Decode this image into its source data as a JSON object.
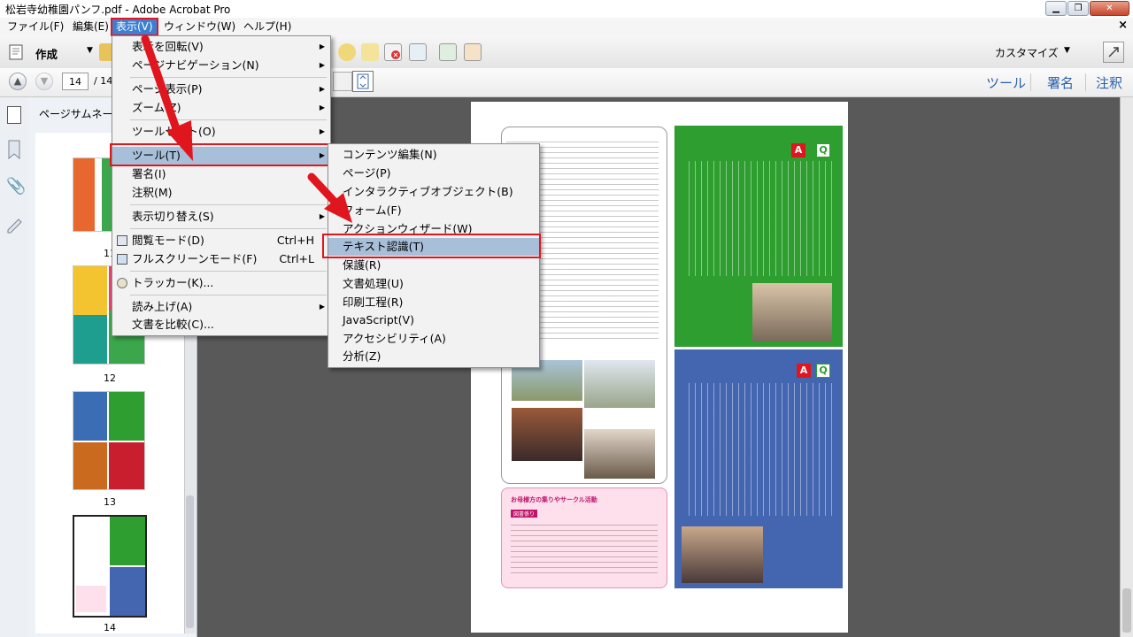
{
  "window": {
    "title": "松岩寺幼稚園パンフ.pdf - Adobe Acrobat Pro"
  },
  "menubar": [
    {
      "label": "ファイル(F)"
    },
    {
      "label": "編集(E)"
    },
    {
      "label": "表示(V)"
    },
    {
      "label": "ウィンドウ(W)"
    },
    {
      "label": "ヘルプ(H)"
    }
  ],
  "toolbar": {
    "create_label": "作成",
    "customize_label": "カスタマイズ"
  },
  "nav": {
    "page_current": "14",
    "page_total": "/ 14"
  },
  "pane_tabs": {
    "tools": "ツール",
    "sign": "署名",
    "comment": "注釈"
  },
  "thumbnails": {
    "title": "ページサムネール",
    "labels": [
      "11",
      "12",
      "13",
      "14"
    ]
  },
  "view_menu": [
    {
      "label": "表示を回転(V)",
      "submenu": true
    },
    {
      "label": "ページナビゲーション(N)",
      "submenu": true
    },
    {
      "label": "ページ表示(P)",
      "submenu": true
    },
    {
      "label": "ズーム(Z)",
      "submenu": true
    },
    {
      "label": "ツールセット(O)",
      "submenu": true
    },
    {
      "label": "ツール(T)",
      "submenu": true
    },
    {
      "label": "署名(I)",
      "submenu": true
    },
    {
      "label": "注釈(M)",
      "submenu": true
    },
    {
      "label": "表示切り替え(S)",
      "submenu": true
    },
    {
      "label": "閲覧モード(D)",
      "shortcut": "Ctrl+H"
    },
    {
      "label": "フルスクリーンモード(F)",
      "shortcut": "Ctrl+L"
    },
    {
      "label": "トラッカー(K)..."
    },
    {
      "label": "読み上げ(A)",
      "submenu": true
    },
    {
      "label": "文書を比較(C)..."
    }
  ],
  "tools_submenu": [
    {
      "label": "コンテンツ編集(N)"
    },
    {
      "label": "ページ(P)"
    },
    {
      "label": "インタラクティブオブジェクト(B)"
    },
    {
      "label": "フォーム(F)"
    },
    {
      "label": "アクションウィザード(W)"
    },
    {
      "label": "テキスト認識(T)"
    },
    {
      "label": "保護(R)"
    },
    {
      "label": "文書処理(U)"
    },
    {
      "label": "印刷工程(R)"
    },
    {
      "label": "JavaScript(V)"
    },
    {
      "label": "アクセシビリティ(A)"
    },
    {
      "label": "分析(Z)"
    }
  ],
  "document": {
    "badge_a": "A",
    "badge_q": "Q",
    "pink_box_title": "お母様方の集りやサークル活動",
    "pink_box_subtitle": "図書係り"
  },
  "colors": {
    "highlight_red": "#e0161f",
    "menu_hover": "#a7bfd9",
    "page_green": "#2d9e2f",
    "page_blue": "#4466b0",
    "pink_box": "#fde0ec"
  }
}
